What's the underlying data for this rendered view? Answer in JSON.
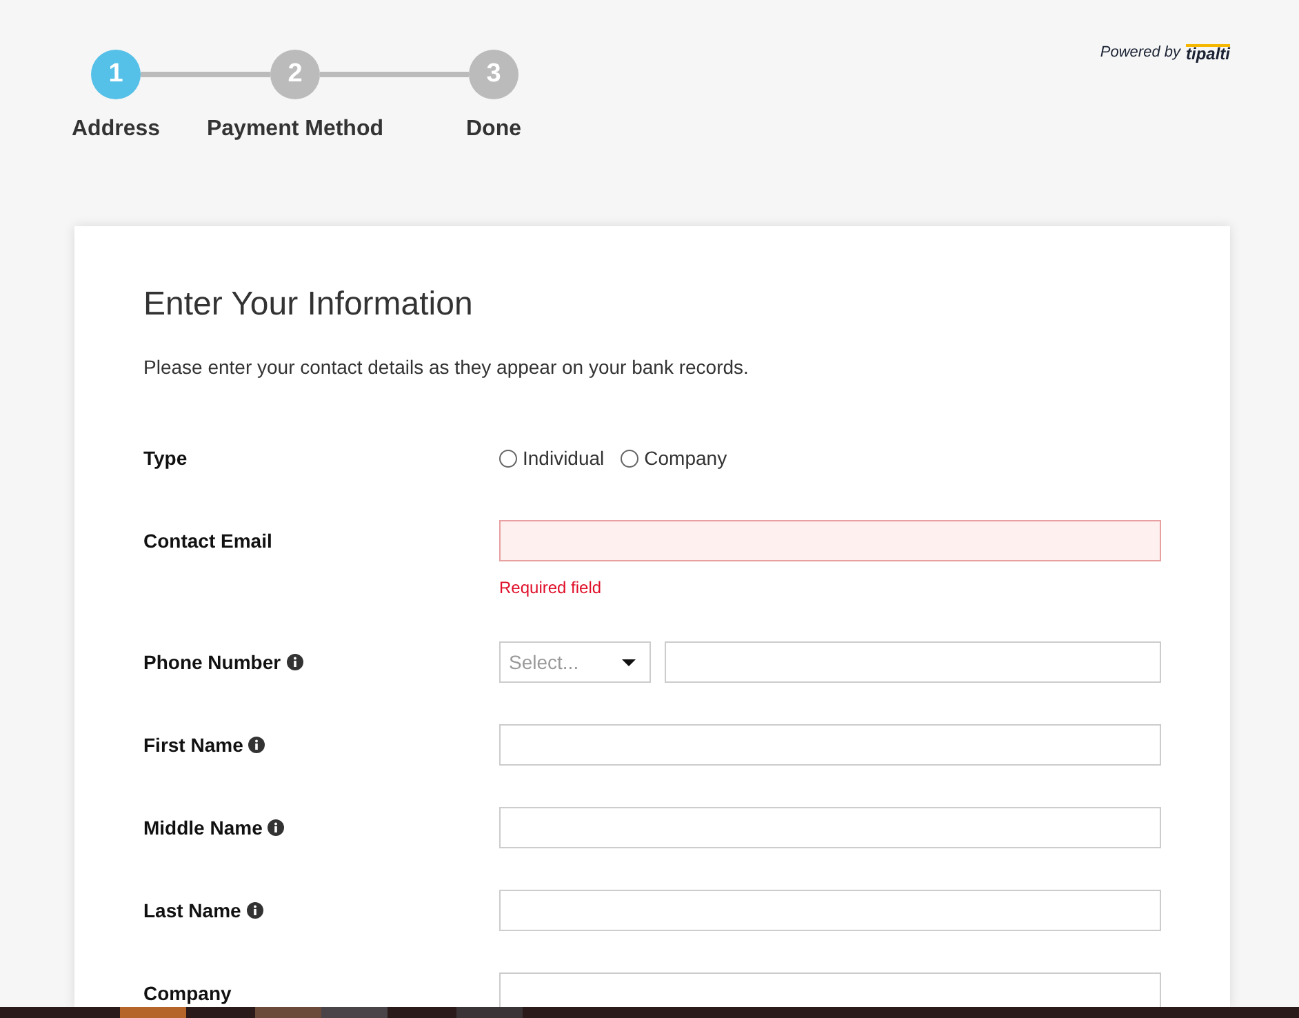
{
  "steps": [
    {
      "number": "1",
      "label": "Address",
      "selected": true
    },
    {
      "number": "2",
      "label": "Payment Method",
      "selected": false
    },
    {
      "number": "3",
      "label": "Done",
      "selected": false
    }
  ],
  "powered_by": {
    "text": "Powered by",
    "brand": "tipalti"
  },
  "form": {
    "title": "Enter Your Information",
    "subtitle": "Please enter your contact details as they appear on your bank records.",
    "fields": [
      {
        "kind": "radio",
        "label": "Type",
        "info": false,
        "options": [
          {
            "label": "Individual",
            "selected": false
          },
          {
            "label": "Company",
            "selected": false
          }
        ]
      },
      {
        "kind": "text",
        "label": "Contact Email",
        "info": false,
        "error": "Required field"
      },
      {
        "kind": "phone",
        "label": "Phone Number",
        "info": true,
        "placeholder": "Select..."
      },
      {
        "kind": "text",
        "label": "First Name",
        "info": true
      },
      {
        "kind": "text",
        "label": "Middle Name",
        "info": true
      },
      {
        "kind": "text",
        "label": "Last Name",
        "info": true
      },
      {
        "kind": "text",
        "label": "Company",
        "info": false
      }
    ]
  }
}
